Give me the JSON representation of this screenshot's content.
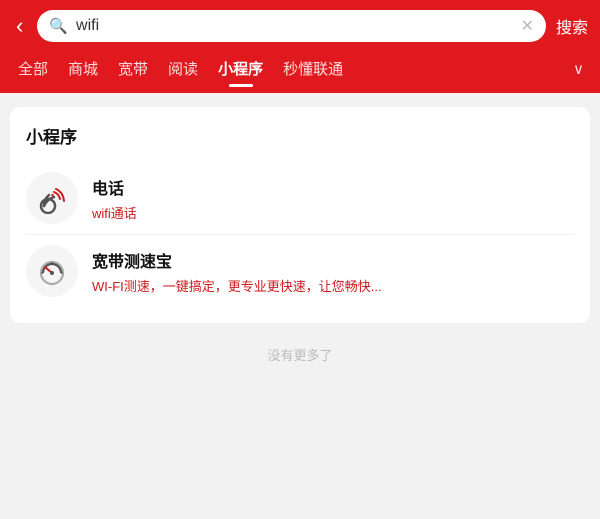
{
  "header": {
    "back_label": "‹",
    "search_value": "wifi",
    "clear_icon": "✕",
    "search_button": "搜索"
  },
  "tabs": [
    {
      "id": "all",
      "label": "全部",
      "active": false
    },
    {
      "id": "mall",
      "label": "商城",
      "active": false
    },
    {
      "id": "broadband",
      "label": "宽带",
      "active": false
    },
    {
      "id": "reading",
      "label": "阅读",
      "active": false
    },
    {
      "id": "miniapp",
      "label": "小程序",
      "active": true
    },
    {
      "id": "quick",
      "label": "秒懂联通",
      "active": false
    }
  ],
  "tabs_more": "∨",
  "section": {
    "title": "小程序",
    "items": [
      {
        "id": "phone",
        "name": "电话",
        "desc": "wifi通话",
        "icon": "📞"
      },
      {
        "id": "speed",
        "name": "宽带测速宝",
        "desc": "WI-FI测速，一键搞定，更专业更快速，让您畅快...",
        "icon": "⏱"
      }
    ]
  },
  "no_more_text": "没有更多了"
}
